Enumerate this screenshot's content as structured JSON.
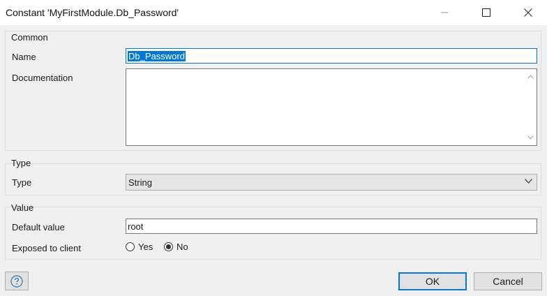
{
  "window": {
    "title": "Constant 'MyFirstModule.Db_Password'",
    "controls": [
      "minimize-icon",
      "maximize-icon",
      "close-icon"
    ]
  },
  "common": {
    "title": "Common",
    "name_label": "Name",
    "name_value": "Db_Password",
    "documentation_label": "Documentation",
    "documentation_value": ""
  },
  "type": {
    "title": "Type",
    "type_label": "Type",
    "type_value": "String"
  },
  "value": {
    "title": "Value",
    "default_label": "Default value",
    "default_value": "root",
    "exposed_label": "Exposed to client",
    "options": [
      {
        "label": "Yes",
        "checked": false
      },
      {
        "label": "No",
        "checked": true
      }
    ]
  },
  "footer": {
    "help_icon": "help-icon",
    "ok_label": "OK",
    "cancel_label": "Cancel"
  },
  "colors": {
    "accent": "#0078d7",
    "background": "#f0f0f0"
  }
}
